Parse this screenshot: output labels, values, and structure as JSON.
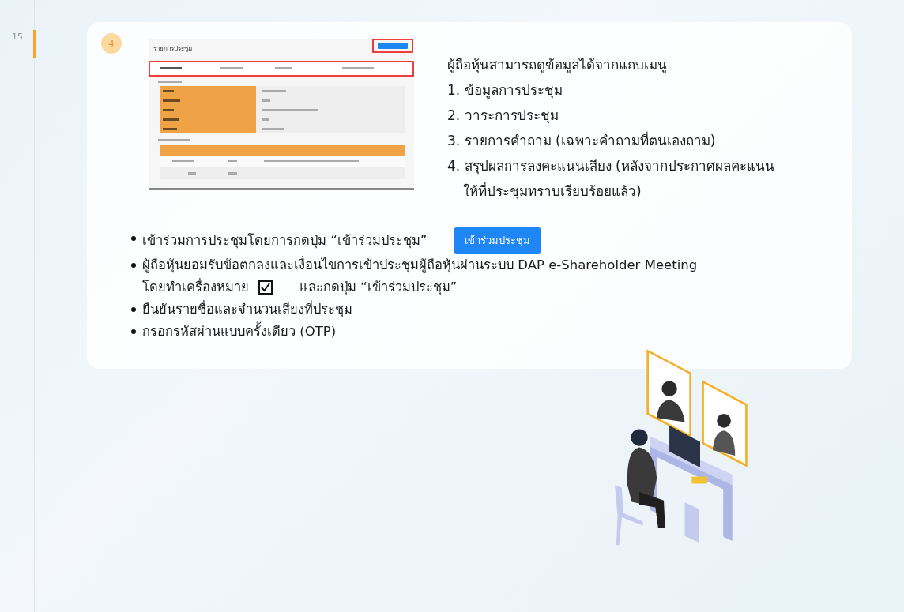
{
  "page_number": "15",
  "step": {
    "number": "4"
  },
  "preview": {
    "title": "รายการประชุม"
  },
  "intro": "ผู้ถือหุ้นสามารถดูข้อมูลได้จากแถบเมนู",
  "menu_items": [
    "1. ข้อมูลการประชุม",
    "2. วาระการประชุม",
    "3. รายการคำถาม (เฉพาะคำถามที่ตนเองถาม)",
    "4. สรุปผลการลงคะแนนเสียง (หลังจากประกาศผลคะแนน ให้ที่ประชุมทราบเรียบร้อยแล้ว)"
  ],
  "bullets": [
    {
      "kind": "button",
      "text": "เข้าร่วมการประชุมโดยการกดปุ่ม “เข้าร่วมประชุม”",
      "button": "เข้าร่วมประชุม"
    },
    {
      "kind": "checkbox",
      "text": "ผู้ถือหุ้นยอมรับข้อตกลงและเงื่อนไขการเข้าประชุมผู้ถือหุ้นผ่านระบบ DAP e-Shareholder Meeting",
      "before": "โดยทำเครื่องหมาย",
      "checked": true,
      "after": "และกดปุ่ม “เข้าร่วมประชุม”"
    },
    {
      "kind": "plain",
      "text": "ยืนยันรายชื่อและจำนวนเสียงที่ประชุม"
    },
    {
      "kind": "plain",
      "text": "กรอกรหัสผ่านแบบครั้งเดียว (OTP)"
    }
  ]
}
